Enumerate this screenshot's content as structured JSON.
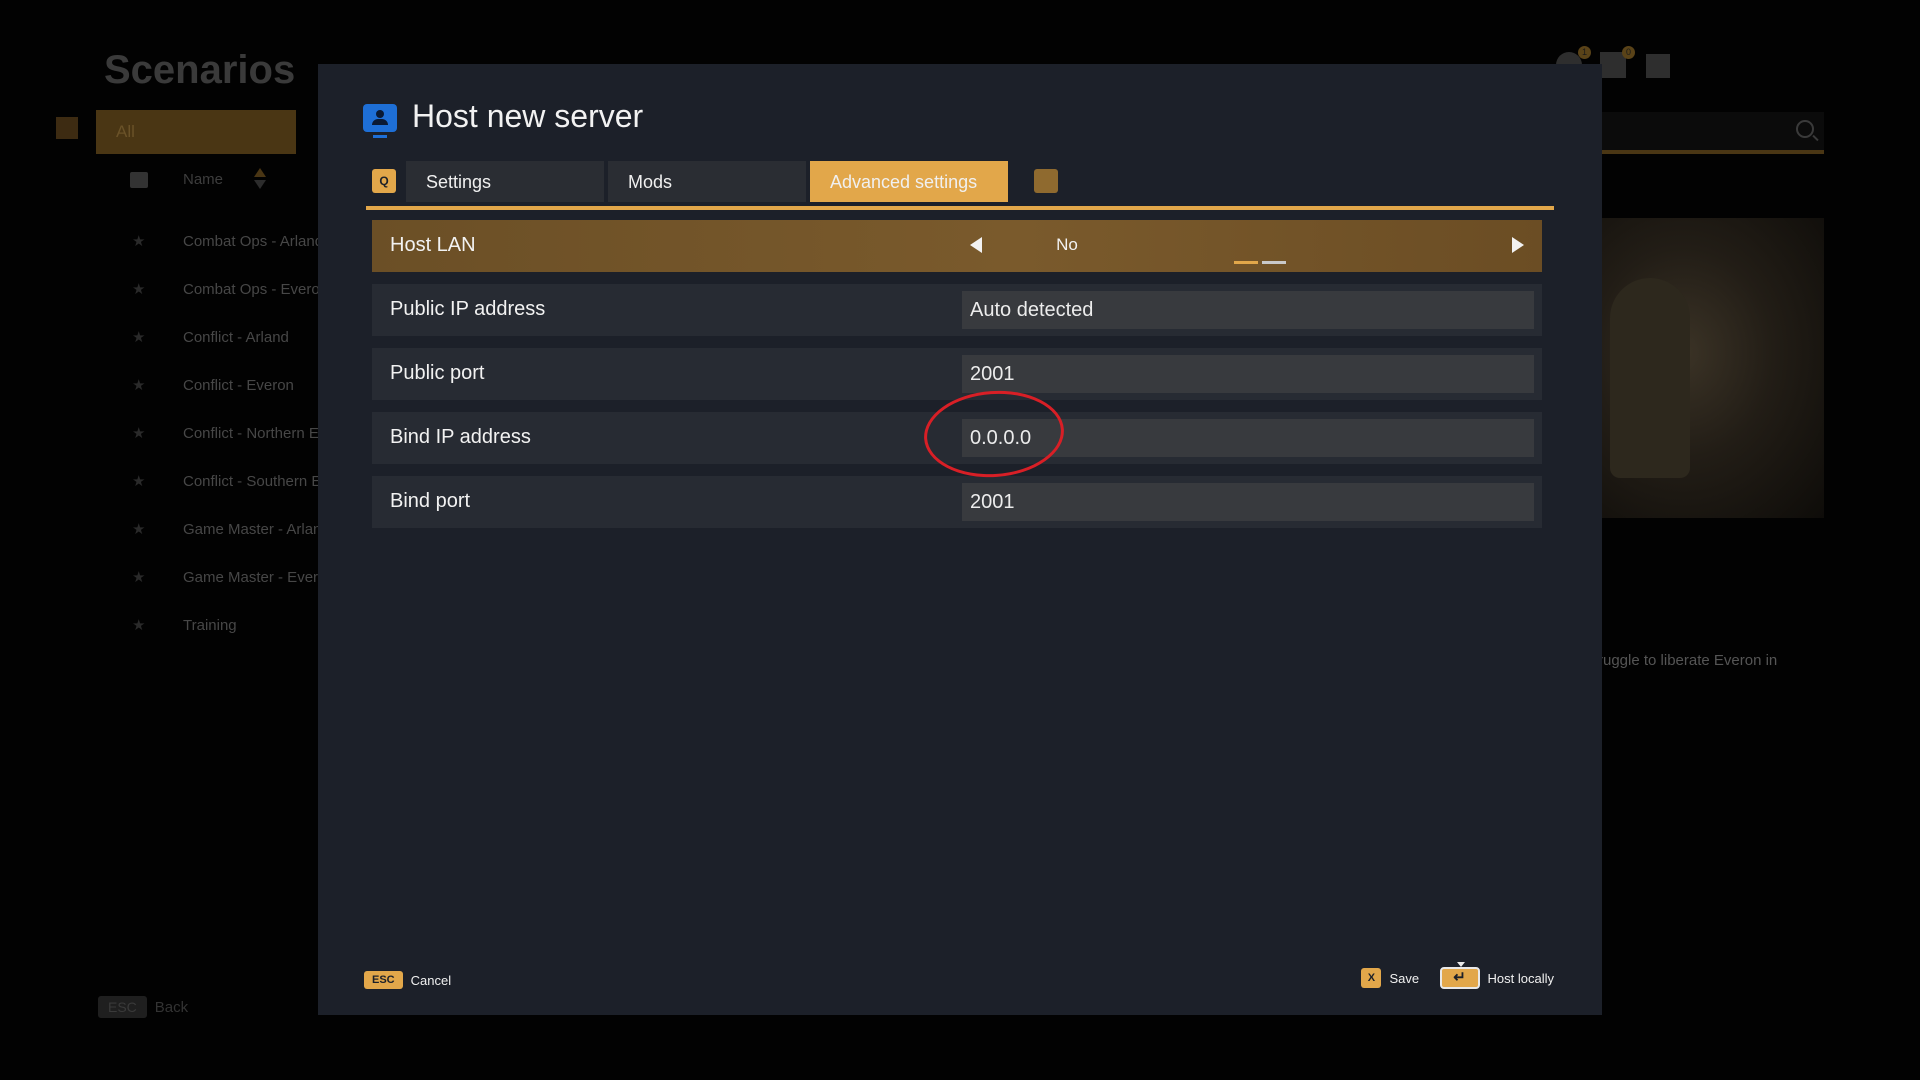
{
  "background": {
    "title": "Scenarios",
    "filter_tab": "All",
    "column_name": "Name",
    "scenarios": [
      "Combat Ops - Arland",
      "Combat Ops - Everon",
      "Conflict - Arland",
      "Conflict - Everon",
      "Conflict - Northern Ev",
      "Conflict - Southern Ev",
      "Game Master - Arland",
      "Game Master - Everon",
      "Training"
    ],
    "description": "ruggle to liberate Everon in",
    "back_key": "ESC",
    "back_label": "Back",
    "badges": [
      "1",
      "0"
    ]
  },
  "dialog": {
    "title": "Host new server",
    "tabs": {
      "left_key": "Q",
      "items": [
        "Settings",
        "Mods",
        "Advanced settings"
      ],
      "active": "Advanced settings"
    },
    "rows": {
      "host_lan": {
        "label": "Host LAN",
        "value": "No",
        "options_count": 2,
        "selected_index": 0
      },
      "public_ip": {
        "label": "Public IP address",
        "value": "Auto detected"
      },
      "public_port": {
        "label": "Public port",
        "value": "2001"
      },
      "bind_ip": {
        "label": "Bind IP address",
        "value": "0.0.0.0"
      },
      "bind_port": {
        "label": "Bind port",
        "value": "2001"
      }
    },
    "footer": {
      "cancel_key": "ESC",
      "cancel_label": "Cancel",
      "save_key": "X",
      "save_label": "Save",
      "host_key": "↵",
      "host_label": "Host locally"
    }
  },
  "colors": {
    "accent": "#e2a74a",
    "dialog_bg": "#1c2029",
    "row_bg": "#272b33",
    "input_bg": "#383a3e",
    "annotation": "#d81f26"
  }
}
